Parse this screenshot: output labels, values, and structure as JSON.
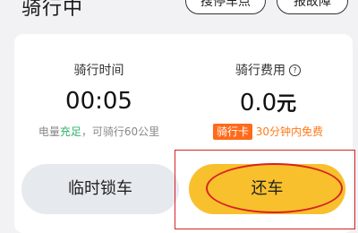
{
  "header": {
    "title": "骑行中",
    "park_button": "搜停车点",
    "report_button": "报故障"
  },
  "ride": {
    "time_label": "骑行时间",
    "time_value": "00:05",
    "battery_prefix": "电量",
    "battery_status": "充足",
    "range_text": "，可骑行60公里",
    "fee_label": "骑行费用",
    "fee_info_icon": "?",
    "fee_amount": "0.0",
    "fee_unit": "元",
    "card_badge": "骑行卡",
    "free_text": "30分钟内免费"
  },
  "actions": {
    "lock_label": "临时锁车",
    "return_label": "还车"
  },
  "colors": {
    "return_button": "#f8c02c",
    "lock_button": "#e6e9ee",
    "battery_ok": "#2fb46b",
    "badge": "#ff6a1a",
    "annotation": "#d62323"
  }
}
